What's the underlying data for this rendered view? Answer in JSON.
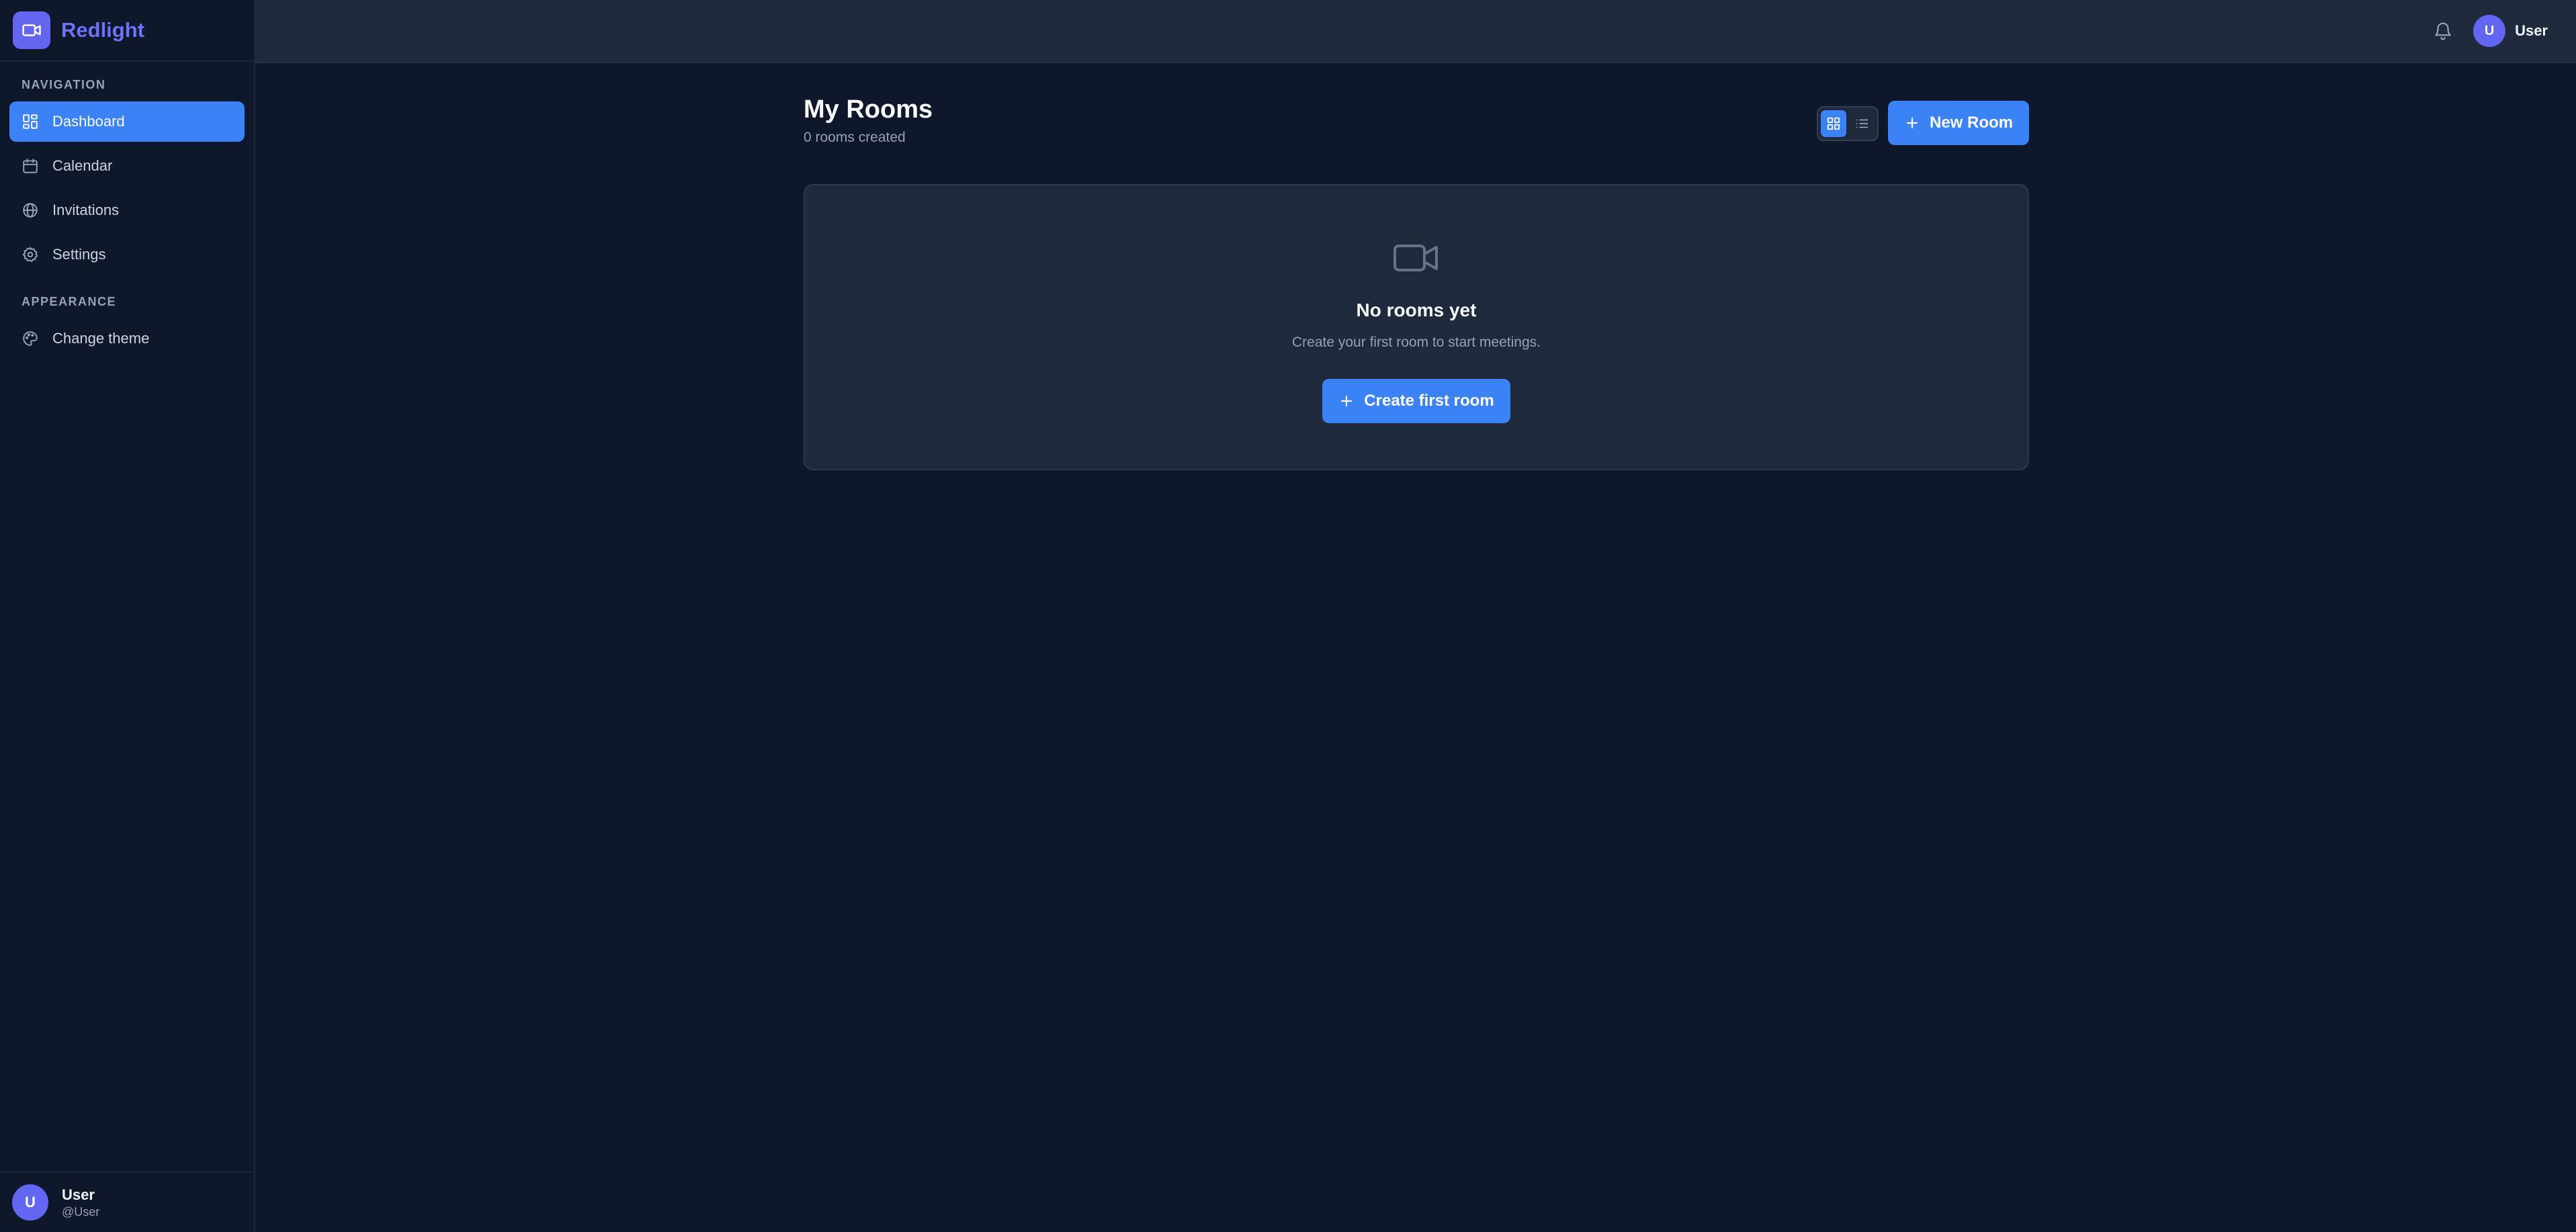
{
  "app": {
    "name": "Redlight"
  },
  "sidebar": {
    "navigation_label": "NAVIGATION",
    "items": [
      {
        "label": "Dashboard",
        "icon": "dashboard-icon",
        "active": true
      },
      {
        "label": "Calendar",
        "icon": "calendar-icon",
        "active": false
      },
      {
        "label": "Invitations",
        "icon": "globe-icon",
        "active": false
      },
      {
        "label": "Settings",
        "icon": "gear-icon",
        "active": false
      }
    ],
    "appearance_label": "APPEARANCE",
    "appearance_items": [
      {
        "label": "Change theme",
        "icon": "palette-icon"
      }
    ],
    "user": {
      "initial": "U",
      "name": "User",
      "handle": "@User"
    }
  },
  "topbar": {
    "user": {
      "initial": "U",
      "name": "User"
    }
  },
  "main": {
    "title": "My Rooms",
    "subtitle": "0 rooms created",
    "new_room_label": "New Room",
    "view_mode": "grid",
    "empty": {
      "title": "No rooms yet",
      "subtitle": "Create your first room to start meetings.",
      "button_label": "Create first room"
    }
  },
  "colors": {
    "background": "#0f172a",
    "surface": "#1e293b",
    "accent": "#3b82f6",
    "brand": "#6366f1"
  }
}
